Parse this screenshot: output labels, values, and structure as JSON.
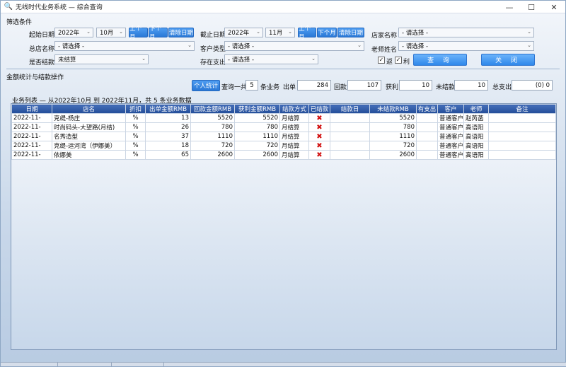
{
  "window": {
    "title": "无线时代业务系统 — 综合查询"
  },
  "filters": {
    "section": "筛选条件",
    "start_date": {
      "label": "起始日期",
      "year": "2022年",
      "month": "10月"
    },
    "end_date": {
      "label": "截止日期",
      "year": "2022年",
      "month": "11月"
    },
    "prev_month": "上个月",
    "next_month": "下个月",
    "clear_date": "清除日期",
    "shop_name": {
      "label": "店家名称",
      "value": "- 请选择 -"
    },
    "head_shop": {
      "label": "总店名称",
      "value": "- 请选择 -"
    },
    "customer_type": {
      "label": "客户类型",
      "value": "- 请选择 -"
    },
    "teacher_name": {
      "label": "老师姓名",
      "value": "- 请选择 -"
    },
    "settled": {
      "label": "是否结款",
      "value": "未结算"
    },
    "deposit": {
      "label": "存在支出",
      "value": "- 请选择 -"
    },
    "rebate_label": "返",
    "profit_label": "利",
    "query_button": "查 询",
    "close_button": "关 闭"
  },
  "stats": {
    "section": "金额统计与结款操作",
    "personal_button": "个人统计",
    "query_prefix": "查询一共",
    "count": "5",
    "count_suffix": "条业务",
    "out_label": "出单",
    "out_value": "284",
    "return_label": "回款",
    "return_value": "107",
    "profit_label": "获利",
    "profit_value": "10",
    "unsettled_label": "未结款",
    "unsettled_value": "10",
    "expense_label": "总支出",
    "expense_value": "(0) 0"
  },
  "list": {
    "title": "业务列表 — 从2022年10月 到 2022年11月，共 5 条业务数据",
    "headers": [
      "日期",
      "店名",
      "折扣",
      "出单金额RMB",
      "回款金额RMB",
      "获利金额RMB",
      "结款方式",
      "已结款",
      "结款日",
      "未结款RMB",
      "有支出",
      "客户",
      "老师",
      "备注"
    ],
    "rows": [
      [
        "2022-11-",
        "克缇-杨庄",
        "%",
        "13",
        "5520",
        "5520",
        "月结算",
        "",
        "",
        "5520",
        "",
        "普通客户",
        "赵芮菡",
        ""
      ],
      [
        "2022-11-",
        "时尚码头-大望路(月结)",
        "%",
        "26",
        "780",
        "780",
        "月结算",
        "",
        "",
        "780",
        "",
        "普通客户",
        "高语阳",
        ""
      ],
      [
        "2022-11-",
        "名秀造型",
        "%",
        "37",
        "1110",
        "1110",
        "月结算",
        "",
        "",
        "1110",
        "",
        "普通客户",
        "高语阳",
        ""
      ],
      [
        "2022-11-",
        "克缇-运河湾（伊娜美）",
        "%",
        "18",
        "720",
        "720",
        "月结算",
        "",
        "",
        "720",
        "",
        "普通客户",
        "高语阳",
        ""
      ],
      [
        "2022-11-",
        "依娜美",
        "%",
        "65",
        "2600",
        "2600",
        "月结算",
        "",
        "",
        "2600",
        "",
        "普通客户",
        "高语阳",
        ""
      ]
    ]
  }
}
